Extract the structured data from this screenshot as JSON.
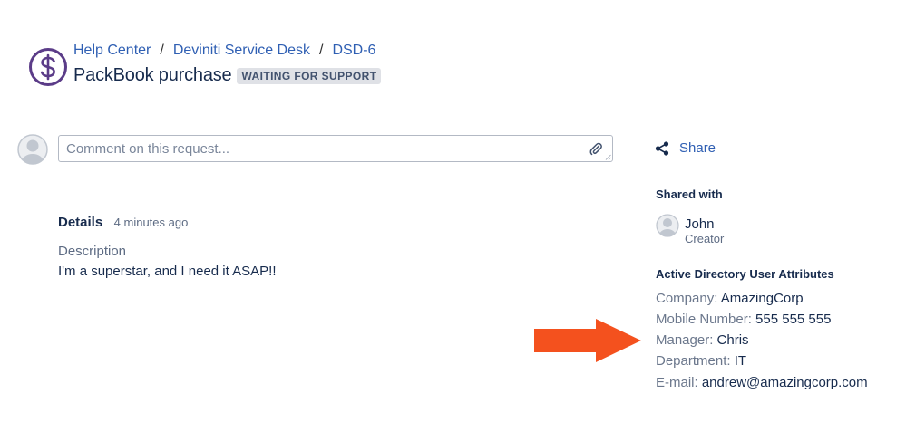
{
  "header": {
    "breadcrumb": [
      "Help Center",
      "Deviniti Service Desk",
      "DSD-6"
    ],
    "breadcrumb_separator": "/",
    "title": "PackBook purchase",
    "status": "WAITING FOR SUPPORT",
    "request_type_icon": "dollar-circle-icon"
  },
  "comment": {
    "placeholder": "Comment on this request...",
    "value": ""
  },
  "activity": {
    "details_label": "Details",
    "timestamp": "4 minutes ago",
    "description_label": "Description",
    "description": "I'm a superstar, and I need it ASAP!!"
  },
  "sidebar": {
    "share_label": "Share",
    "shared_with_heading": "Shared with",
    "shared_user": {
      "name": "John",
      "role": "Creator"
    },
    "ad_heading": "Active Directory User Attributes",
    "attributes": [
      {
        "label": "Company:",
        "value": "AmazingCorp"
      },
      {
        "label": "Mobile Number:",
        "value": "555 555 555"
      },
      {
        "label": "Manager:",
        "value": "Chris"
      },
      {
        "label": "Department:",
        "value": "IT"
      },
      {
        "label": "E-mail:",
        "value": "andrew@amazingcorp.com"
      }
    ]
  },
  "colors": {
    "link": "#2f5fb3",
    "icon_purple": "#5b3c88",
    "arrow": "#f4511e",
    "badge_bg": "#dfe1e6"
  }
}
